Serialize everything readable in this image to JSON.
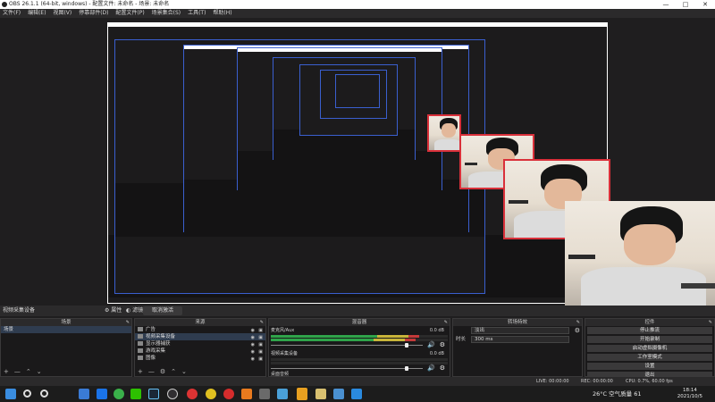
{
  "titlebar": {
    "title": "OBS 26.1.1 (64-bit, windows) - 配置文件: 未命名 - 场景: 未命名",
    "min": "—",
    "max": "□",
    "close": "✕"
  },
  "menubar": [
    "文件(F)",
    "编辑(E)",
    "视图(V)",
    "停靠部件(D)",
    "配置文件(P)",
    "场景集合(S)",
    "工具(T)",
    "帮助(H)"
  ],
  "scene_tabs": {
    "label": "视频采集设备",
    "properties": "属性",
    "filters": "滤镜",
    "deactivate": "取消激活"
  },
  "panels": {
    "scenes": {
      "title": "场景",
      "items": [
        "场景"
      ]
    },
    "sources": {
      "title": "来源",
      "items": [
        "广告",
        "视频采集设备",
        "显示器捕获",
        "游戏采集",
        "图像"
      ]
    },
    "mixer": {
      "title": "混音器",
      "channels": [
        {
          "name": "麦克风/Aux",
          "db": "0.0 dB",
          "level": 0.82,
          "volume": 0.95
        },
        {
          "name": "视频采集设备",
          "db": "0.0 dB",
          "level": 0.0,
          "volume": 0.95
        },
        {
          "name": "桌面音频",
          "db": "",
          "level": 0.0,
          "volume": 0.95
        }
      ]
    },
    "transitions": {
      "title": "转场特效",
      "type": "淡出",
      "duration_label": "时长",
      "duration": "300 ms"
    },
    "controls": {
      "title": "控件",
      "buttons": [
        "停止推流",
        "开始录制",
        "启动虚拟摄像机",
        "工作室模式",
        "设置",
        "退出"
      ]
    }
  },
  "statusbar": {
    "live": "LIVE: 00:00:00",
    "rec": "REC: 00:00:00",
    "cpu": "CPU: 0.7%, 60.00 fps"
  },
  "taskbar": {
    "weather": "26°C 空气质量 61",
    "time": "18:14",
    "date": "2021/10/5",
    "icons": [
      "windows-icon",
      "search-icon",
      "task-view-icon",
      "explorer-icon",
      "edge-icon",
      "phone-icon",
      "wechat-icon",
      "steam-icon",
      "obs-icon",
      "chrome-icon",
      "media-icon",
      "netease-icon",
      "store-icon",
      "app-icon",
      "settings-icon",
      "ide-icon",
      "game-icon",
      "mail-icon",
      "terminal-icon"
    ]
  },
  "colors": {
    "accent_red": "#d9303a",
    "accent_blue": "#3a5fcf",
    "meter_green": "#2fa44a"
  }
}
